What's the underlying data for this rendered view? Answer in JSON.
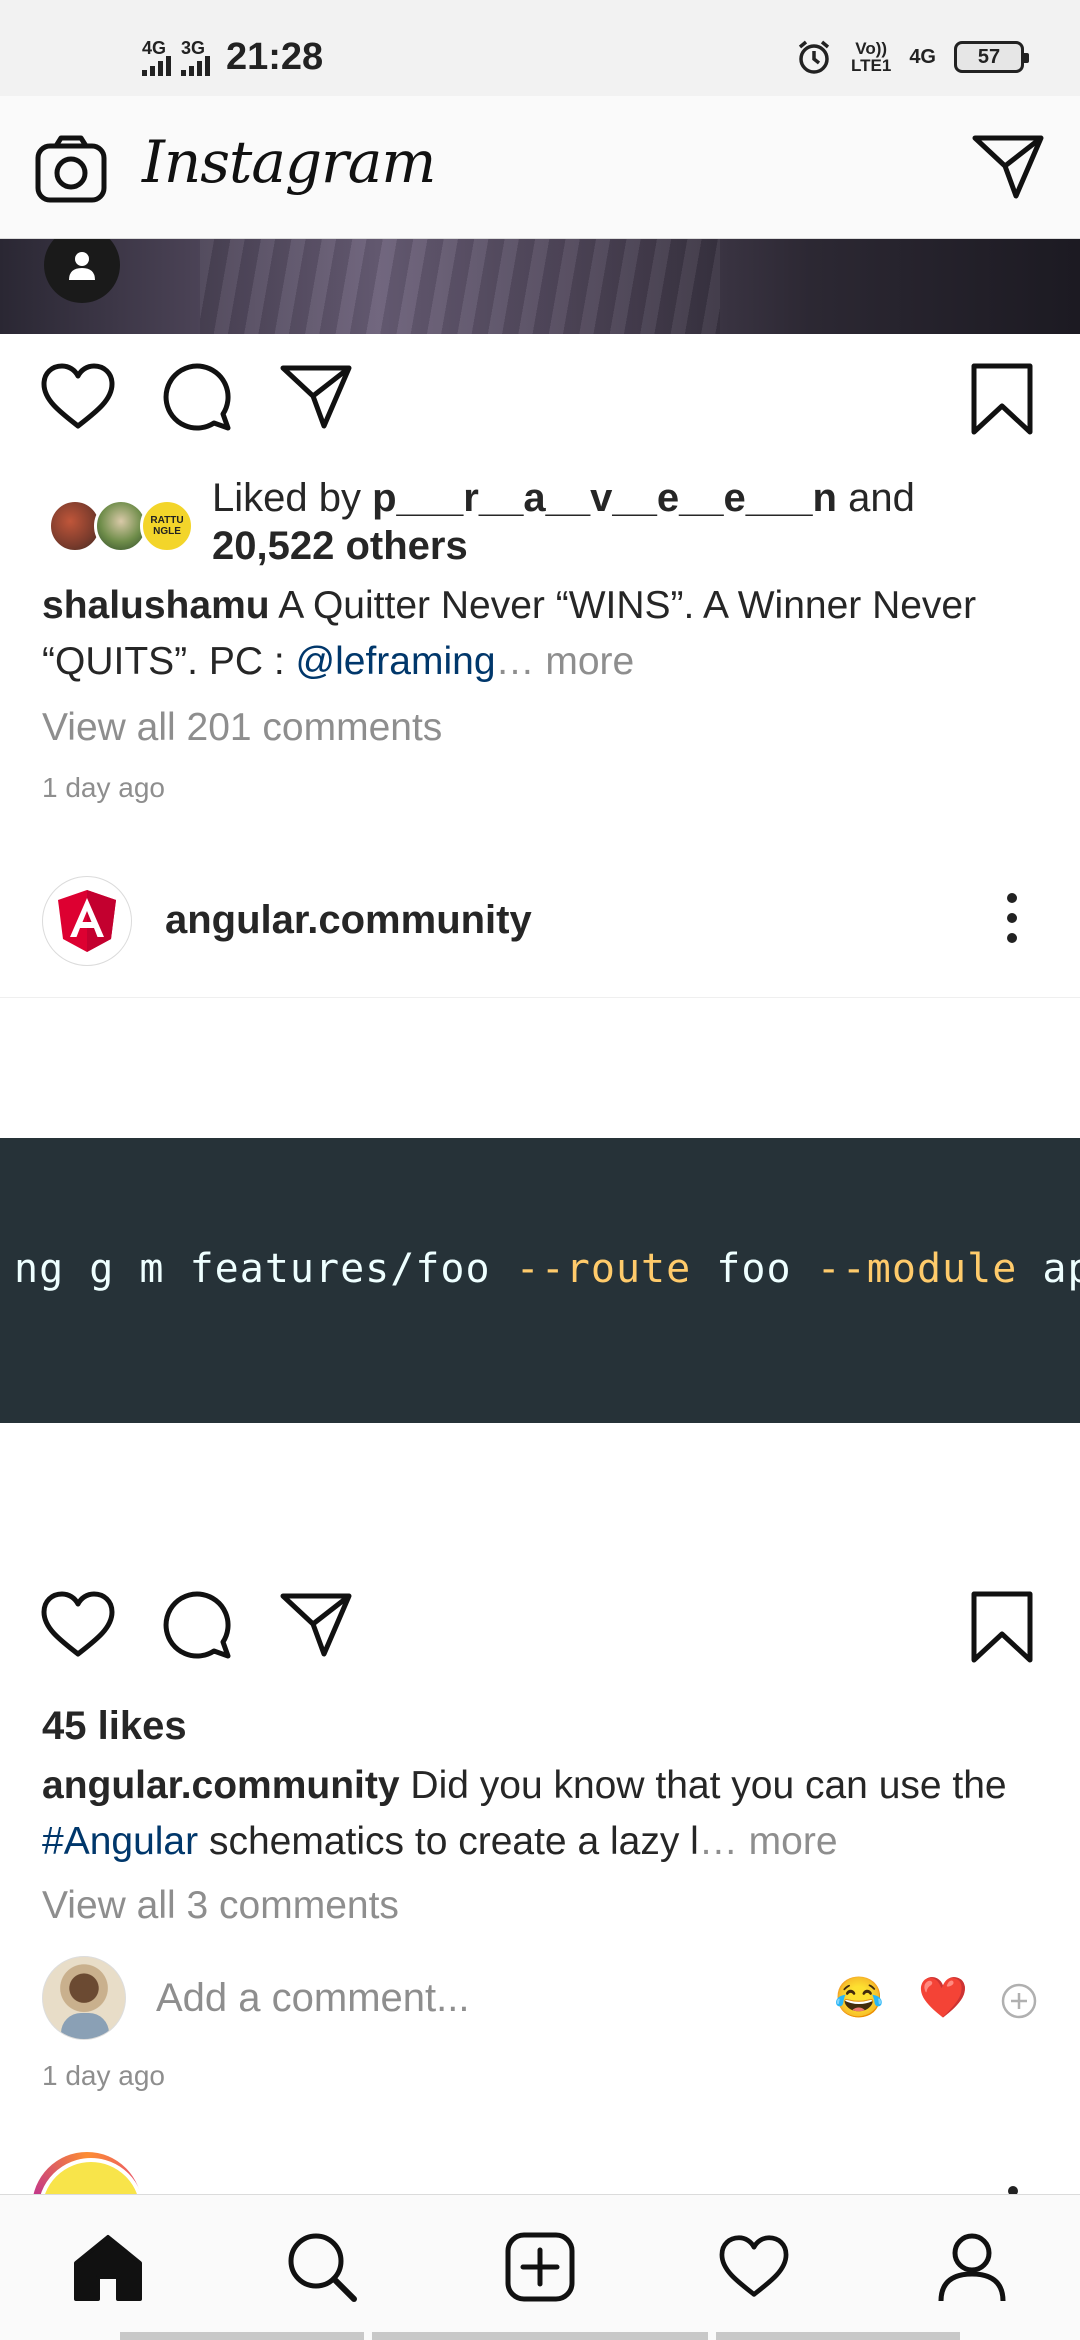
{
  "status_bar": {
    "sim1_network": "4G",
    "sim2_network": "3G",
    "time": "21:28",
    "volte_line1": "Vo))",
    "volte_line2": "LTE1",
    "data_network": "4G",
    "battery": "57"
  },
  "app_bar": {
    "title": "Instagram"
  },
  "post1": {
    "liked_by_prefix": "Liked by",
    "liked_by_user": "p___r__a__v__e__e___n",
    "liked_by_and": "and",
    "liked_by_others": "20,522 others",
    "caption_user": "shalushamu",
    "caption_text": "A Quitter Never “WINS”. A Winner Never “QUITS”. PC :",
    "caption_mention": "@leframing",
    "caption_more": "… more",
    "view_all_comments": "View all 201 comments",
    "time_ago": "1 day ago",
    "liker_avatar_3_text_line1": "RATTU",
    "liker_avatar_3_text_line2": "NGLE"
  },
  "post2": {
    "username": "angular.community",
    "code_segments": [
      {
        "text": "ng g m features/foo ",
        "kind": "plain"
      },
      {
        "text": "--route",
        "kind": "flag"
      },
      {
        "text": " foo ",
        "kind": "plain"
      },
      {
        "text": "--module",
        "kind": "flag"
      },
      {
        "text": " app",
        "kind": "plain"
      }
    ],
    "likes": "45 likes",
    "caption_user": "angular.community",
    "caption_text_1": "Did you know that you can use the",
    "caption_hashtag": "#Angular",
    "caption_text_2": "schematics to create a lazy l",
    "caption_more": "… more",
    "view_all_comments": "View all 3 comments",
    "add_comment_placeholder": "Add a comment...",
    "quick_reactions": [
      "😂",
      "❤️"
    ],
    "time_ago": "1 day ago"
  },
  "bottom_nav": {
    "items": [
      "home-icon",
      "search-icon",
      "new-post-icon",
      "activity-icon",
      "profile-icon"
    ]
  },
  "colors": {
    "link": "#00376b",
    "muted": "#8e8e8e",
    "code_background": "#263238",
    "code_flag": "#ffcb6b",
    "angular_red": "#dd0031"
  }
}
